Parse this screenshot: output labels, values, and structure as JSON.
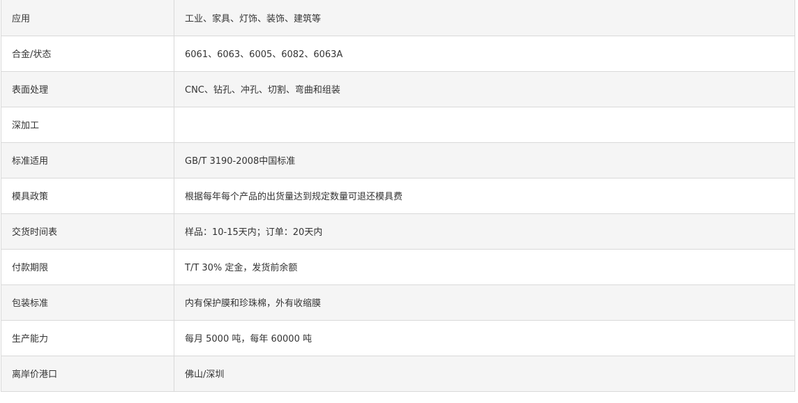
{
  "spec_rows": [
    {
      "label": "应用",
      "value": "工业、家具、灯饰、装饰、建筑等"
    },
    {
      "label": "合金/状态",
      "value": "6061、6063、6005、6082、6063A"
    },
    {
      "label": "表面处理",
      "value": "CNC、钻孔、冲孔、切割、弯曲和组装"
    },
    {
      "label": "深加工",
      "value": ""
    },
    {
      "label": "标准适用",
      "value": "GB/T 3190-2008中国标准"
    },
    {
      "label": "模具政策",
      "value": "根据每年每个产品的出货量达到规定数量可退还模具费"
    },
    {
      "label": "交货时间表",
      "value": "样品：10-15天内；订单：20天内"
    },
    {
      "label": "付款期限",
      "value": "T/T 30% 定金，发货前余额"
    },
    {
      "label": "包装标准",
      "value": "内有保护膜和珍珠棉，外有收缩膜"
    },
    {
      "label": "生产能力",
      "value": "每月 5000 吨，每年 60000 吨"
    },
    {
      "label": "离岸价港口",
      "value": "佛山/深圳"
    }
  ]
}
